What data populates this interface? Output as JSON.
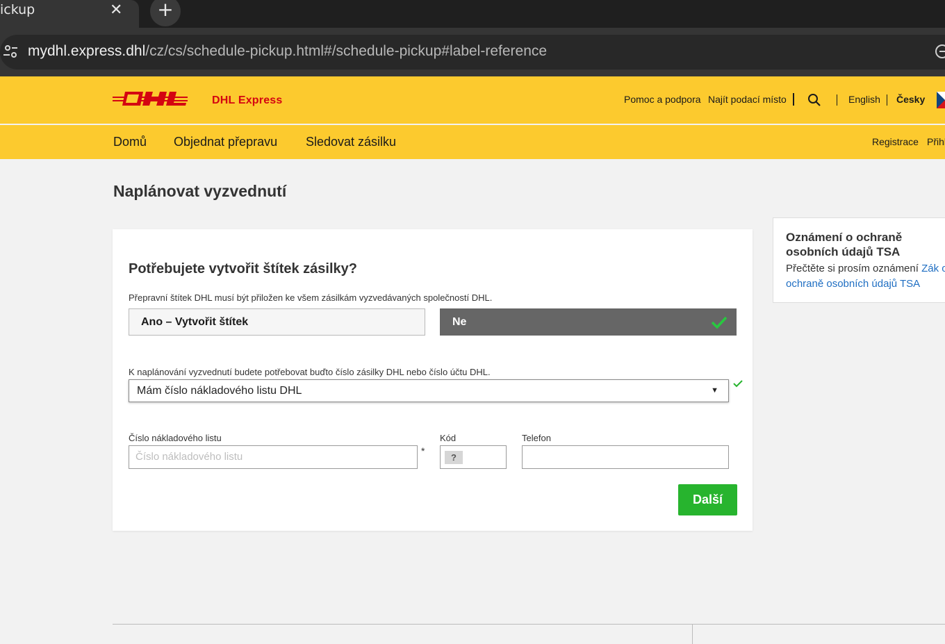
{
  "browser": {
    "tab_title": "ickup",
    "url_host": "mydhl.express.dhl",
    "url_path": "/cz/cs/schedule-pickup.html#/schedule-pickup#label-reference"
  },
  "header": {
    "brand_name": "DHL Express",
    "help_link": "Pomoc a podpora",
    "find_location_link": "Najít podací místo",
    "lang_english": "English",
    "lang_czech": "Česky"
  },
  "nav": {
    "items": [
      "Domů",
      "Objednat přepravu",
      "Sledovat zásilku"
    ],
    "register": "Registrace",
    "login": "Přihl"
  },
  "page": {
    "title": "Naplánovat vyzvednutí"
  },
  "form": {
    "question": "Potřebujete vytvořit štítek zásilky?",
    "question_desc": "Přepravní štítek DHL musí být přiložen ke všem zásilkám vyzvedávaných společností DHL.",
    "yes_label": "Ano – Vytvořit štítek",
    "no_label": "Ne",
    "select_label": "K naplánování vyzvednutí budete potřebovat buďto číslo zásilky DHL nebo číslo účtu DHL.",
    "select_value": "Mám číslo nákladového listu DHL",
    "waybill_label": "Číslo nákladového listu",
    "waybill_placeholder": "Číslo nákladového listu",
    "required_mark": "*",
    "code_label": "Kód",
    "code_help": "?",
    "phone_label": "Telefon",
    "next_button": "Další"
  },
  "notice": {
    "title": "Oznámení o ochraně osobních údajů TSA",
    "text": "Přečtěte si prosím oznámení ",
    "link": "Zák o ochraně osobních údajů TSA"
  },
  "colors": {
    "brand_yellow": "#fcca2e",
    "brand_red": "#d40511",
    "success_green": "#27b42e"
  }
}
